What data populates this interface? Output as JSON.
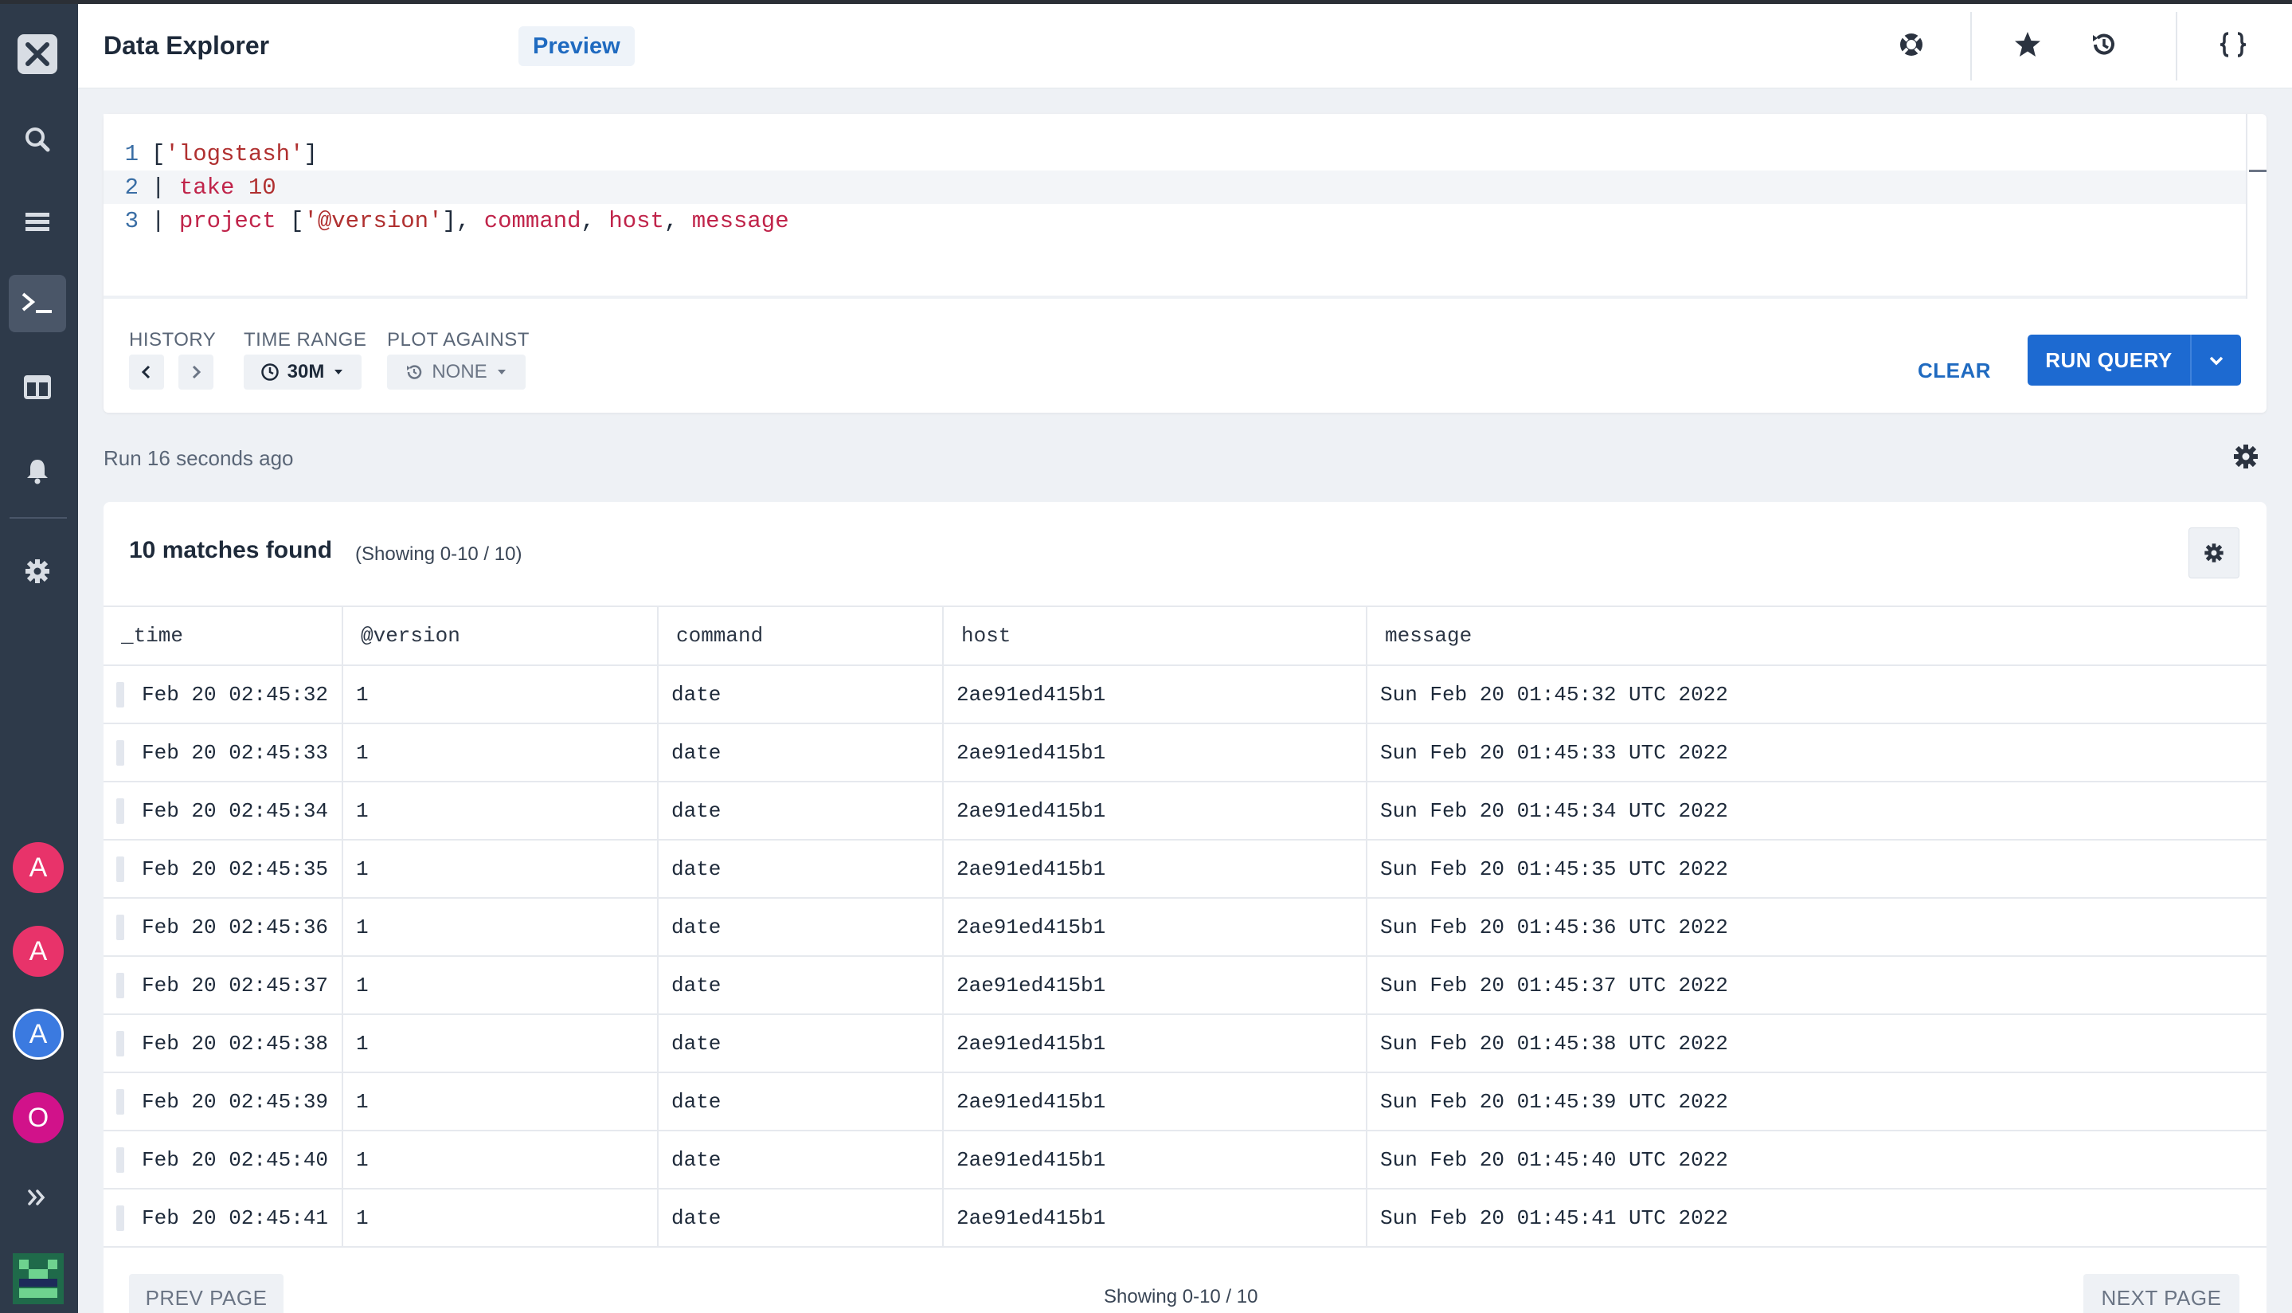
{
  "app": {
    "title": "Data Explorer",
    "badge": "Preview"
  },
  "sidebar": {
    "avatars": [
      {
        "letter": "A",
        "color": "#e8336a"
      },
      {
        "letter": "A",
        "color": "#e8336a"
      },
      {
        "letter": "A",
        "color": "#3b7ae0"
      },
      {
        "letter": "O",
        "color": "#d1128a"
      }
    ]
  },
  "editor": {
    "line_numbers": [
      "1",
      "2",
      "3"
    ],
    "line1": {
      "open": "[",
      "str": "'logstash'",
      "close": "]"
    },
    "line2": {
      "pipe": "| ",
      "kw": "take",
      "arg": " 10"
    },
    "line3": {
      "pipe": "| ",
      "kw": "project",
      "open": " [",
      "str": "'@version'",
      "close": "], ",
      "id1": "command",
      "c1": ", ",
      "id2": "host",
      "c2": ", ",
      "id3": "message"
    }
  },
  "controls": {
    "history_label": "HISTORY",
    "time_range_label": "TIME RANGE",
    "time_range_value": "30M",
    "plot_against_label": "PLOT AGAINST",
    "plot_against_value": "NONE",
    "clear_label": "CLEAR",
    "run_label": "RUN QUERY"
  },
  "status": {
    "run_text": "Run 16 seconds ago"
  },
  "results": {
    "matches": "10 matches found",
    "showing": "(Showing 0-10 / 10)",
    "columns": [
      "_time",
      "@version",
      "command",
      "host",
      "message"
    ],
    "rows": [
      [
        "Feb 20 02:45:32",
        "1",
        "date",
        "2ae91ed415b1",
        "Sun Feb 20 01:45:32 UTC 2022"
      ],
      [
        "Feb 20 02:45:33",
        "1",
        "date",
        "2ae91ed415b1",
        "Sun Feb 20 01:45:33 UTC 2022"
      ],
      [
        "Feb 20 02:45:34",
        "1",
        "date",
        "2ae91ed415b1",
        "Sun Feb 20 01:45:34 UTC 2022"
      ],
      [
        "Feb 20 02:45:35",
        "1",
        "date",
        "2ae91ed415b1",
        "Sun Feb 20 01:45:35 UTC 2022"
      ],
      [
        "Feb 20 02:45:36",
        "1",
        "date",
        "2ae91ed415b1",
        "Sun Feb 20 01:45:36 UTC 2022"
      ],
      [
        "Feb 20 02:45:37",
        "1",
        "date",
        "2ae91ed415b1",
        "Sun Feb 20 01:45:37 UTC 2022"
      ],
      [
        "Feb 20 02:45:38",
        "1",
        "date",
        "2ae91ed415b1",
        "Sun Feb 20 01:45:38 UTC 2022"
      ],
      [
        "Feb 20 02:45:39",
        "1",
        "date",
        "2ae91ed415b1",
        "Sun Feb 20 01:45:39 UTC 2022"
      ],
      [
        "Feb 20 02:45:40",
        "1",
        "date",
        "2ae91ed415b1",
        "Sun Feb 20 01:45:40 UTC 2022"
      ],
      [
        "Feb 20 02:45:41",
        "1",
        "date",
        "2ae91ed415b1",
        "Sun Feb 20 01:45:41 UTC 2022"
      ]
    ],
    "prev_label": "PREV PAGE",
    "next_label": "NEXT PAGE",
    "footer_showing": "Showing 0-10 / 10"
  }
}
